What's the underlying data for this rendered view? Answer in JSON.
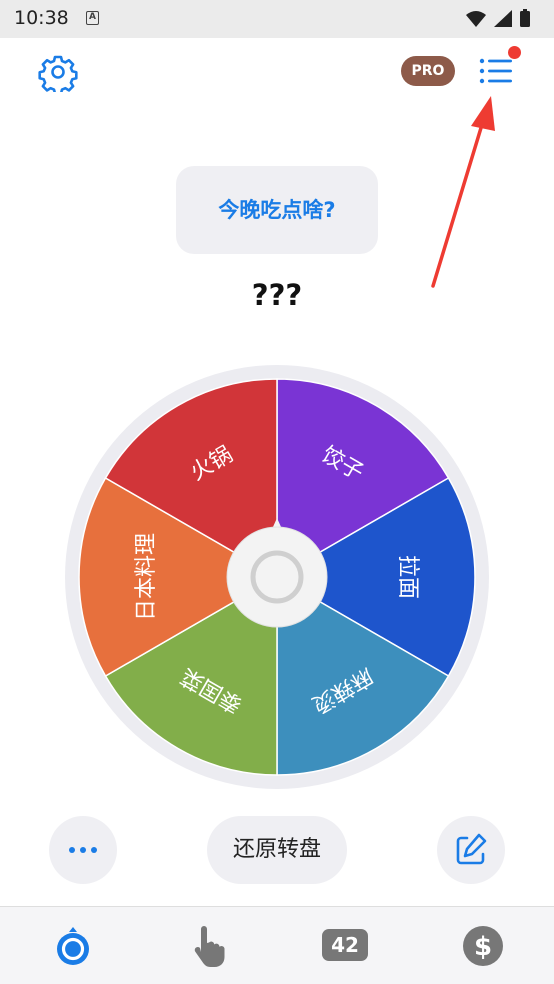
{
  "status_bar": {
    "time": "10:38",
    "notification_letter": "A"
  },
  "header": {
    "pro_label": "PRO",
    "settings_icon": "gear-icon",
    "list_icon": "list-icon",
    "has_notification_dot": true
  },
  "question": {
    "label": "今晚吃点啥?"
  },
  "result": {
    "text": "???"
  },
  "wheel": {
    "segments": [
      {
        "label": "饺子",
        "color": "#7a34d4"
      },
      {
        "label": "拉面",
        "color": "#1e55cc"
      },
      {
        "label": "麻辣烫",
        "color": "#3d8fbd"
      },
      {
        "label": "泰国菜",
        "color": "#82ae4a"
      },
      {
        "label": "日本料理",
        "color": "#e7703d"
      },
      {
        "label": "火锅",
        "color": "#d13539"
      }
    ],
    "center_icon": "spin-button-icon"
  },
  "actions": {
    "more_icon": "more-dots-icon",
    "reset_label": "还原转盘",
    "edit_icon": "edit-icon"
  },
  "tabs": [
    {
      "name": "wheel",
      "icon": "wheel-icon",
      "active": true
    },
    {
      "name": "tap",
      "icon": "hand-pointer-icon",
      "active": false
    },
    {
      "name": "number",
      "icon": "number-icon",
      "label": "42",
      "active": false
    },
    {
      "name": "coin",
      "icon": "dollar-icon",
      "active": false
    }
  ],
  "colors": {
    "accent": "#1a7ce6",
    "pro_badge": "#8d5a49",
    "notification": "#ee3b32",
    "arrow": "#ee3b32"
  }
}
